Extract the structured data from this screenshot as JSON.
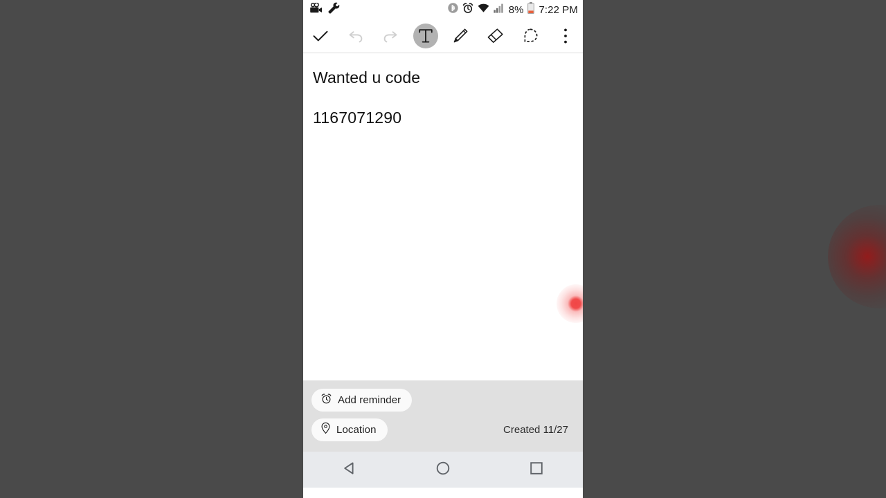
{
  "capture": {
    "backdrop_color": "#4a4a4a",
    "recording_indicator": {
      "name": "screen-recording-dot",
      "color": "#f03c3c",
      "glow_color": "#961919"
    }
  },
  "status_bar": {
    "left_icons": [
      {
        "name": "screen-recorder-icon",
        "label": "Screen recorder"
      },
      {
        "name": "wrench-icon",
        "label": "Developer tools"
      }
    ],
    "right_icons": [
      {
        "name": "bluetooth-icon",
        "label": "Bluetooth"
      },
      {
        "name": "alarm-icon",
        "label": "Alarm set"
      },
      {
        "name": "wifi-icon",
        "label": "Wi-Fi"
      },
      {
        "name": "cellular-signal-icon",
        "label": "Cellular signal"
      }
    ],
    "battery_percent": "8%",
    "battery_level": 8,
    "battery_color": "#e8603c",
    "time": "7:22 PM"
  },
  "toolbar": {
    "items": [
      {
        "name": "done-check-button",
        "label": "Done",
        "icon": "check-icon",
        "state": "enabled"
      },
      {
        "name": "undo-button",
        "label": "Undo",
        "icon": "undo-icon",
        "state": "disabled"
      },
      {
        "name": "redo-button",
        "label": "Redo",
        "icon": "redo-icon",
        "state": "disabled"
      },
      {
        "name": "text-tool-button",
        "label": "Text",
        "icon": "text-t-icon",
        "state": "selected"
      },
      {
        "name": "pen-tool-button",
        "label": "Pen",
        "icon": "pencil-icon",
        "state": "enabled"
      },
      {
        "name": "eraser-tool-button",
        "label": "Eraser",
        "icon": "eraser-icon",
        "state": "enabled"
      },
      {
        "name": "lasso-select-button",
        "label": "Lasso select",
        "icon": "lasso-icon",
        "state": "enabled"
      },
      {
        "name": "overflow-menu-button",
        "label": "More options",
        "icon": "more-vertical-icon",
        "state": "enabled"
      }
    ],
    "selected_color": "#b2b2b2",
    "disabled_color": "#cfcfcf"
  },
  "note": {
    "title": "Wanted u code",
    "body": "1167071290"
  },
  "footer": {
    "reminder_chip": {
      "label": "Add reminder",
      "icon": "alarm-clock-icon"
    },
    "location_chip": {
      "label": "Location",
      "icon": "map-pin-icon"
    },
    "created": "Created 11/27",
    "background_color": "#e0e0e0"
  },
  "nav_bar": {
    "background_color": "#e8eaed",
    "buttons": [
      {
        "name": "nav-back-button",
        "label": "Back",
        "icon": "triangle-left-icon"
      },
      {
        "name": "nav-home-button",
        "label": "Home",
        "icon": "circle-icon"
      },
      {
        "name": "nav-recents-button",
        "label": "Recents",
        "icon": "square-icon"
      }
    ]
  }
}
